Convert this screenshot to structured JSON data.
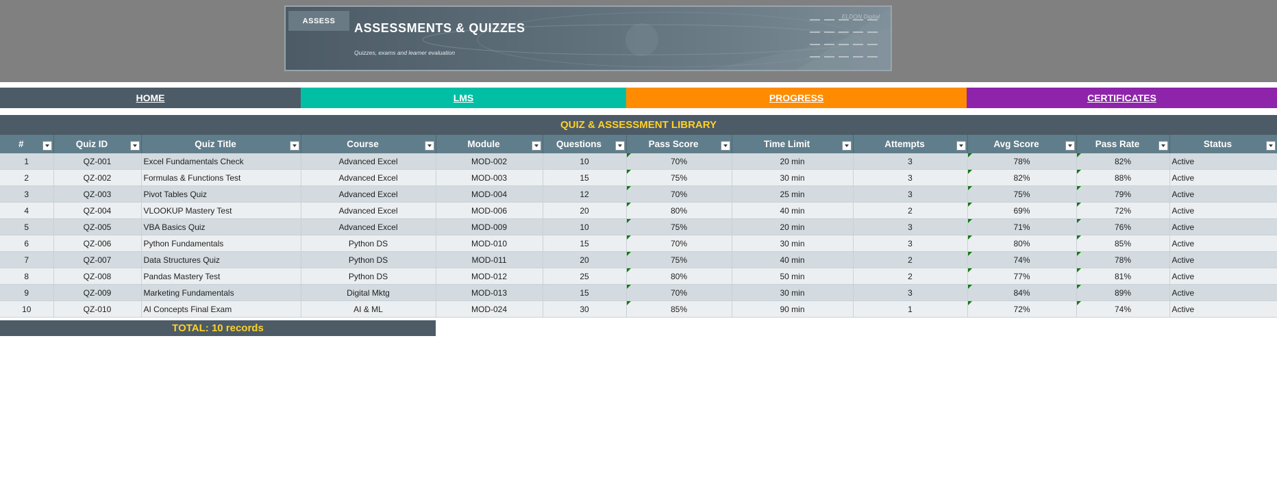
{
  "banner": {
    "tag": "ASSESS",
    "title": "ASSESSMENTS & QUIZZES",
    "subtitle": "Quizzes, exams and learner evaluation",
    "brand": "ELDON Digital"
  },
  "nav": {
    "home": "HOME",
    "lms": "LMS",
    "progress": "PROGRESS",
    "certificates": "CERTIFICATES"
  },
  "colors": {
    "header_dark": "#4c5b66",
    "table_header": "#607d8b",
    "accent_yellow": "#ffd12a",
    "lms_teal": "#00bfa5",
    "progress_orange": "#ff8c00",
    "certificates_purple": "#8e24aa"
  },
  "section_title": "QUIZ & ASSESSMENT LIBRARY",
  "table": {
    "columns": [
      "#",
      "Quiz ID",
      "Quiz Title",
      "Course",
      "Module",
      "Questions",
      "Pass Score",
      "Time Limit",
      "Attempts",
      "Avg Score",
      "Pass Rate",
      "Status"
    ],
    "rows": [
      [
        "1",
        "QZ-001",
        "Excel Fundamentals Check",
        "Advanced Excel",
        "MOD-002",
        "10",
        "70%",
        "20 min",
        "3",
        "78%",
        "82%",
        "Active"
      ],
      [
        "2",
        "QZ-002",
        "Formulas & Functions Test",
        "Advanced Excel",
        "MOD-003",
        "15",
        "75%",
        "30 min",
        "3",
        "82%",
        "88%",
        "Active"
      ],
      [
        "3",
        "QZ-003",
        "Pivot Tables Quiz",
        "Advanced Excel",
        "MOD-004",
        "12",
        "70%",
        "25 min",
        "3",
        "75%",
        "79%",
        "Active"
      ],
      [
        "4",
        "QZ-004",
        "VLOOKUP Mastery Test",
        "Advanced Excel",
        "MOD-006",
        "20",
        "80%",
        "40 min",
        "2",
        "69%",
        "72%",
        "Active"
      ],
      [
        "5",
        "QZ-005",
        "VBA Basics Quiz",
        "Advanced Excel",
        "MOD-009",
        "10",
        "75%",
        "20 min",
        "3",
        "71%",
        "76%",
        "Active"
      ],
      [
        "6",
        "QZ-006",
        "Python Fundamentals",
        "Python DS",
        "MOD-010",
        "15",
        "70%",
        "30 min",
        "3",
        "80%",
        "85%",
        "Active"
      ],
      [
        "7",
        "QZ-007",
        "Data Structures Quiz",
        "Python DS",
        "MOD-011",
        "20",
        "75%",
        "40 min",
        "2",
        "74%",
        "78%",
        "Active"
      ],
      [
        "8",
        "QZ-008",
        "Pandas Mastery Test",
        "Python DS",
        "MOD-012",
        "25",
        "80%",
        "50 min",
        "2",
        "77%",
        "81%",
        "Active"
      ],
      [
        "9",
        "QZ-009",
        "Marketing Fundamentals",
        "Digital Mktg",
        "MOD-013",
        "15",
        "70%",
        "30 min",
        "3",
        "84%",
        "89%",
        "Active"
      ],
      [
        "10",
        "QZ-010",
        "AI Concepts Final Exam",
        "AI & ML",
        "MOD-024",
        "30",
        "85%",
        "90 min",
        "1",
        "72%",
        "74%",
        "Active"
      ]
    ]
  },
  "total": "TOTAL: 10 records"
}
